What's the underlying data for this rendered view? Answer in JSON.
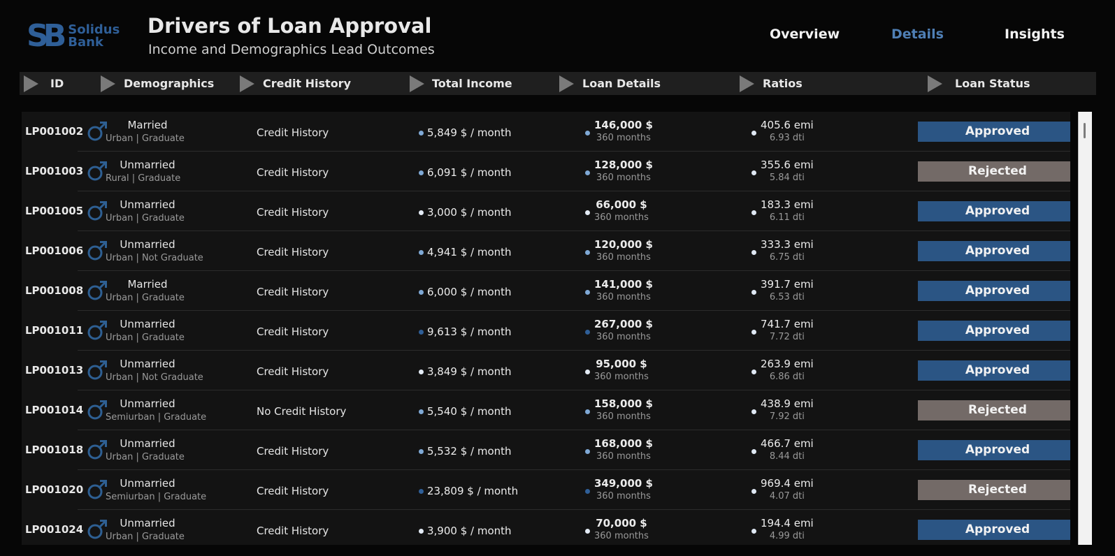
{
  "header": {
    "logo_mark": "SB",
    "logo_line1": "Solidus",
    "logo_line2": "Bank",
    "title": "Drivers of Loan Approval",
    "subtitle": "Income and Demographics Lead Outcomes"
  },
  "nav": [
    {
      "label": "Overview",
      "active": false
    },
    {
      "label": "Details",
      "active": true
    },
    {
      "label": "Insights",
      "active": false
    }
  ],
  "columns": [
    "ID",
    "Demographics",
    "Credit History",
    "Total Income",
    "Loan Details",
    "Ratios",
    "Loan Status"
  ],
  "colors": {
    "accent": "#4f7fb5",
    "approved": "#2b5584",
    "rejected": "#736a67",
    "gender_icon": "#2e5f92",
    "dot_light": "#7fa9d6",
    "dot_dark": "#2f5f98"
  },
  "icons": {
    "gender": "male-icon",
    "column_toggle": "triangle-right-icon"
  },
  "rows": [
    {
      "id": "LP001002",
      "marital": "Married",
      "area": "Urban |  Graduate",
      "credit": "Credit History",
      "income": "5,849 $ / month",
      "income_dot": "light",
      "loan": "146,000 $",
      "term": "360 months",
      "loan_dot": "light",
      "emi": "405.6 emi",
      "dti": "6.93 dti",
      "status": "Approved"
    },
    {
      "id": "LP001003",
      "marital": "Unmarried",
      "area": "Rural |  Graduate",
      "credit": "Credit History",
      "income": "6,091 $ / month",
      "income_dot": "light",
      "loan": "128,000 $",
      "term": "360 months",
      "loan_dot": "light",
      "emi": "355.6 emi",
      "dti": "5.84 dti",
      "status": "Rejected"
    },
    {
      "id": "LP001005",
      "marital": "Unmarried",
      "area": "Urban |  Graduate",
      "credit": "Credit History",
      "income": "3,000 $ / month",
      "income_dot": "white",
      "loan": "66,000 $",
      "term": "360 months",
      "loan_dot": "white",
      "emi": "183.3 emi",
      "dti": "6.11 dti",
      "status": "Approved"
    },
    {
      "id": "LP001006",
      "marital": "Unmarried",
      "area": "Urban |  Not Graduate",
      "credit": "Credit History",
      "income": "4,941 $ / month",
      "income_dot": "light",
      "loan": "120,000 $",
      "term": "360 months",
      "loan_dot": "light",
      "emi": "333.3 emi",
      "dti": "6.75 dti",
      "status": "Approved"
    },
    {
      "id": "LP001008",
      "marital": "Married",
      "area": "Urban |  Graduate",
      "credit": "Credit History",
      "income": "6,000 $ / month",
      "income_dot": "light",
      "loan": "141,000 $",
      "term": "360 months",
      "loan_dot": "light",
      "emi": "391.7 emi",
      "dti": "6.53 dti",
      "status": "Approved"
    },
    {
      "id": "LP001011",
      "marital": "Unmarried",
      "area": "Urban |  Graduate",
      "credit": "Credit History",
      "income": "9,613 $ / month",
      "income_dot": "dark",
      "loan": "267,000 $",
      "term": "360 months",
      "loan_dot": "dark",
      "emi": "741.7 emi",
      "dti": "7.72 dti",
      "status": "Approved"
    },
    {
      "id": "LP001013",
      "marital": "Unmarried",
      "area": "Urban |  Not Graduate",
      "credit": "Credit History",
      "income": "3,849 $ / month",
      "income_dot": "white",
      "loan": "95,000 $",
      "term": "360 months",
      "loan_dot": "white",
      "emi": "263.9 emi",
      "dti": "6.86 dti",
      "status": "Approved"
    },
    {
      "id": "LP001014",
      "marital": "Unmarried",
      "area": "Semiurban |  Graduate",
      "credit": "No Credit History",
      "income": "5,540 $ / month",
      "income_dot": "light",
      "loan": "158,000 $",
      "term": "360 months",
      "loan_dot": "light",
      "emi": "438.9 emi",
      "dti": "7.92 dti",
      "status": "Rejected"
    },
    {
      "id": "LP001018",
      "marital": "Unmarried",
      "area": "Urban |  Graduate",
      "credit": "Credit History",
      "income": "5,532 $ / month",
      "income_dot": "light",
      "loan": "168,000 $",
      "term": "360 months",
      "loan_dot": "light",
      "emi": "466.7 emi",
      "dti": "8.44 dti",
      "status": "Approved"
    },
    {
      "id": "LP001020",
      "marital": "Unmarried",
      "area": "Semiurban |  Graduate",
      "credit": "Credit History",
      "income": "23,809 $ / month",
      "income_dot": "dark",
      "loan": "349,000 $",
      "term": "360 months",
      "loan_dot": "dark",
      "emi": "969.4 emi",
      "dti": "4.07 dti",
      "status": "Rejected"
    },
    {
      "id": "LP001024",
      "marital": "Unmarried",
      "area": "Urban |  Graduate",
      "credit": "Credit History",
      "income": "3,900 $ / month",
      "income_dot": "white",
      "loan": "70,000 $",
      "term": "360 months",
      "loan_dot": "white",
      "emi": "194.4 emi",
      "dti": "4.99 dti",
      "status": "Approved"
    }
  ]
}
